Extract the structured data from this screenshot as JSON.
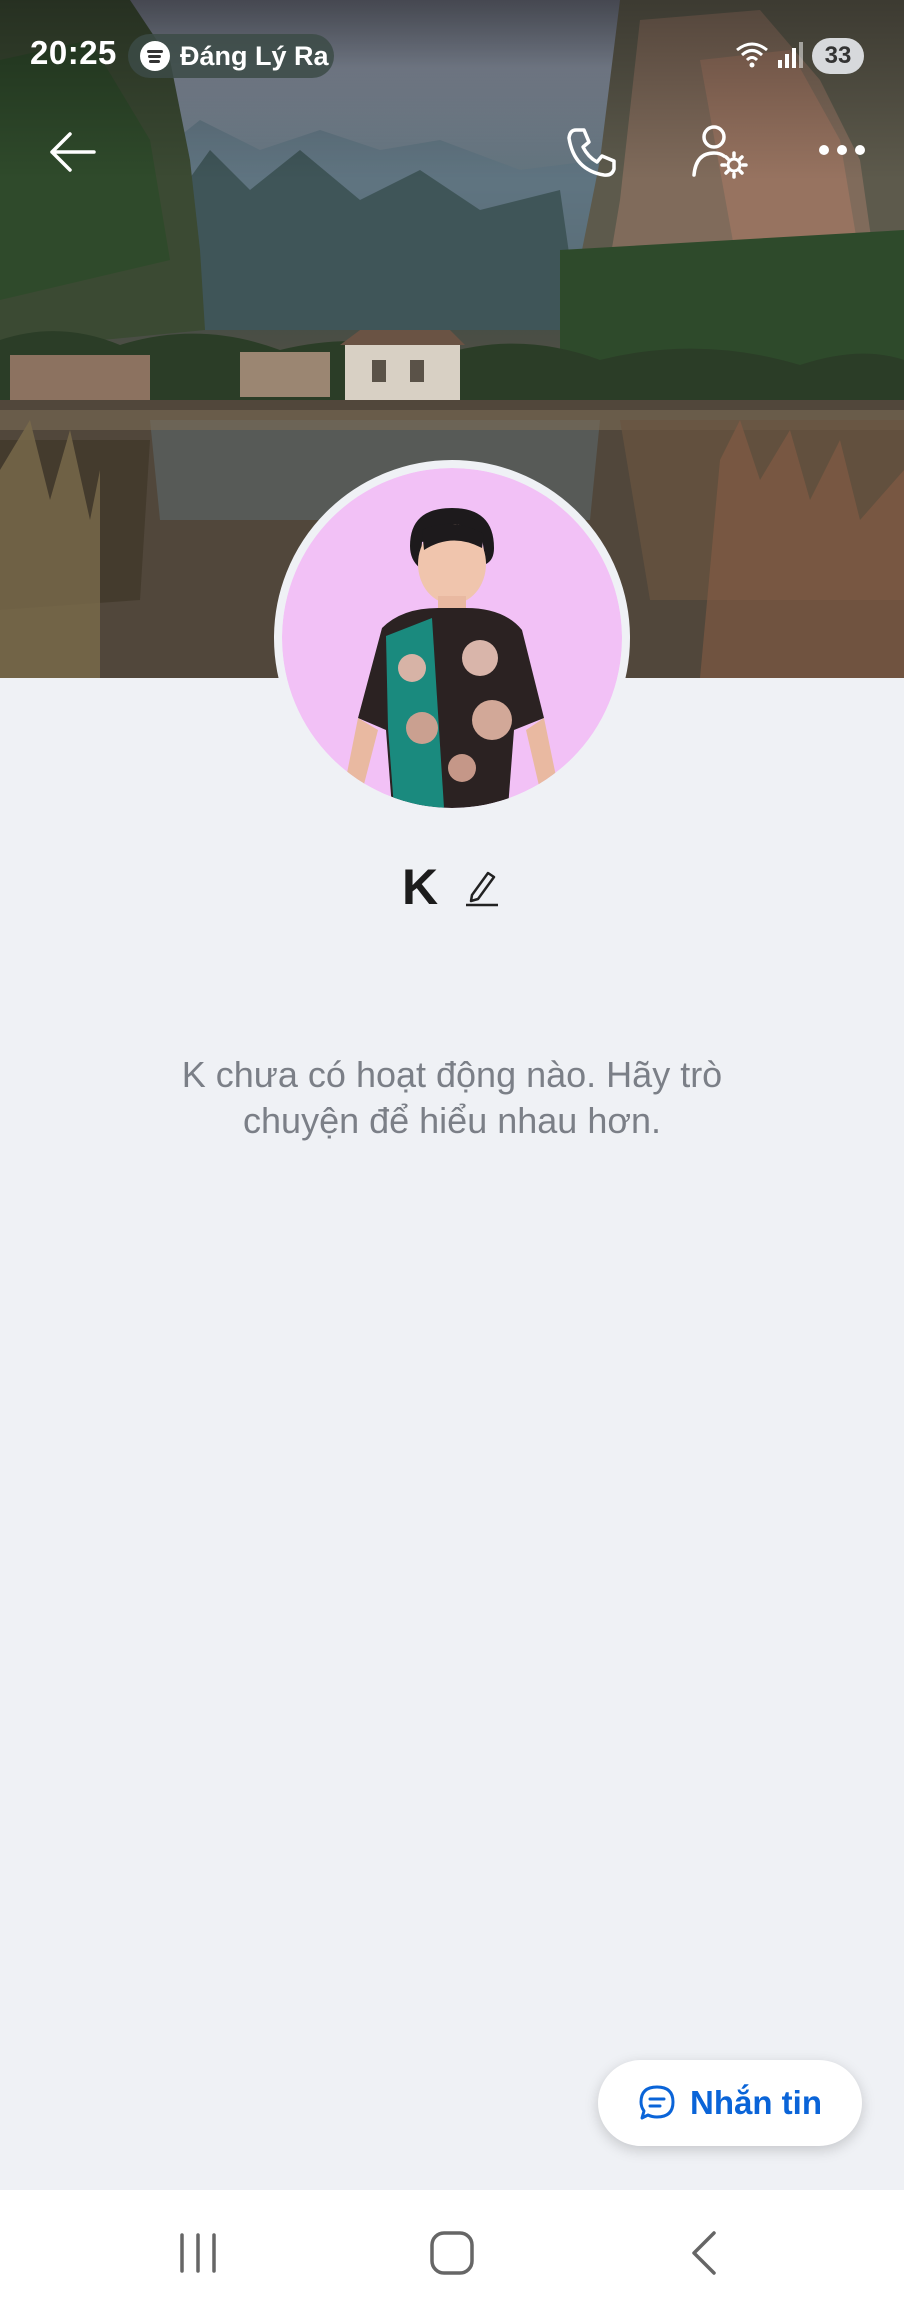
{
  "status_bar": {
    "time": "20:25",
    "media_title": "Đáng Lý Ra",
    "battery": "33",
    "icons": [
      "spotify-icon",
      "wifi-icon",
      "signal-icon",
      "battery-icon"
    ]
  },
  "header": {
    "actions": [
      "back-arrow-icon",
      "phone-icon",
      "user-settings-icon",
      "more-icon"
    ]
  },
  "profile": {
    "name": "K",
    "empty_message": "K chưa có hoạt động nào. Hãy trò chuyện để hiểu nhau hơn."
  },
  "chat_button": {
    "label": "Nhắn tin",
    "color": "#0a64d8"
  },
  "nav_bar": {
    "icons": [
      "recent-apps-icon",
      "home-icon",
      "back-icon"
    ]
  },
  "colors": {
    "background": "#eff1f5",
    "avatar_bg": "#f2c1f6",
    "text_muted": "#7b7f87"
  }
}
